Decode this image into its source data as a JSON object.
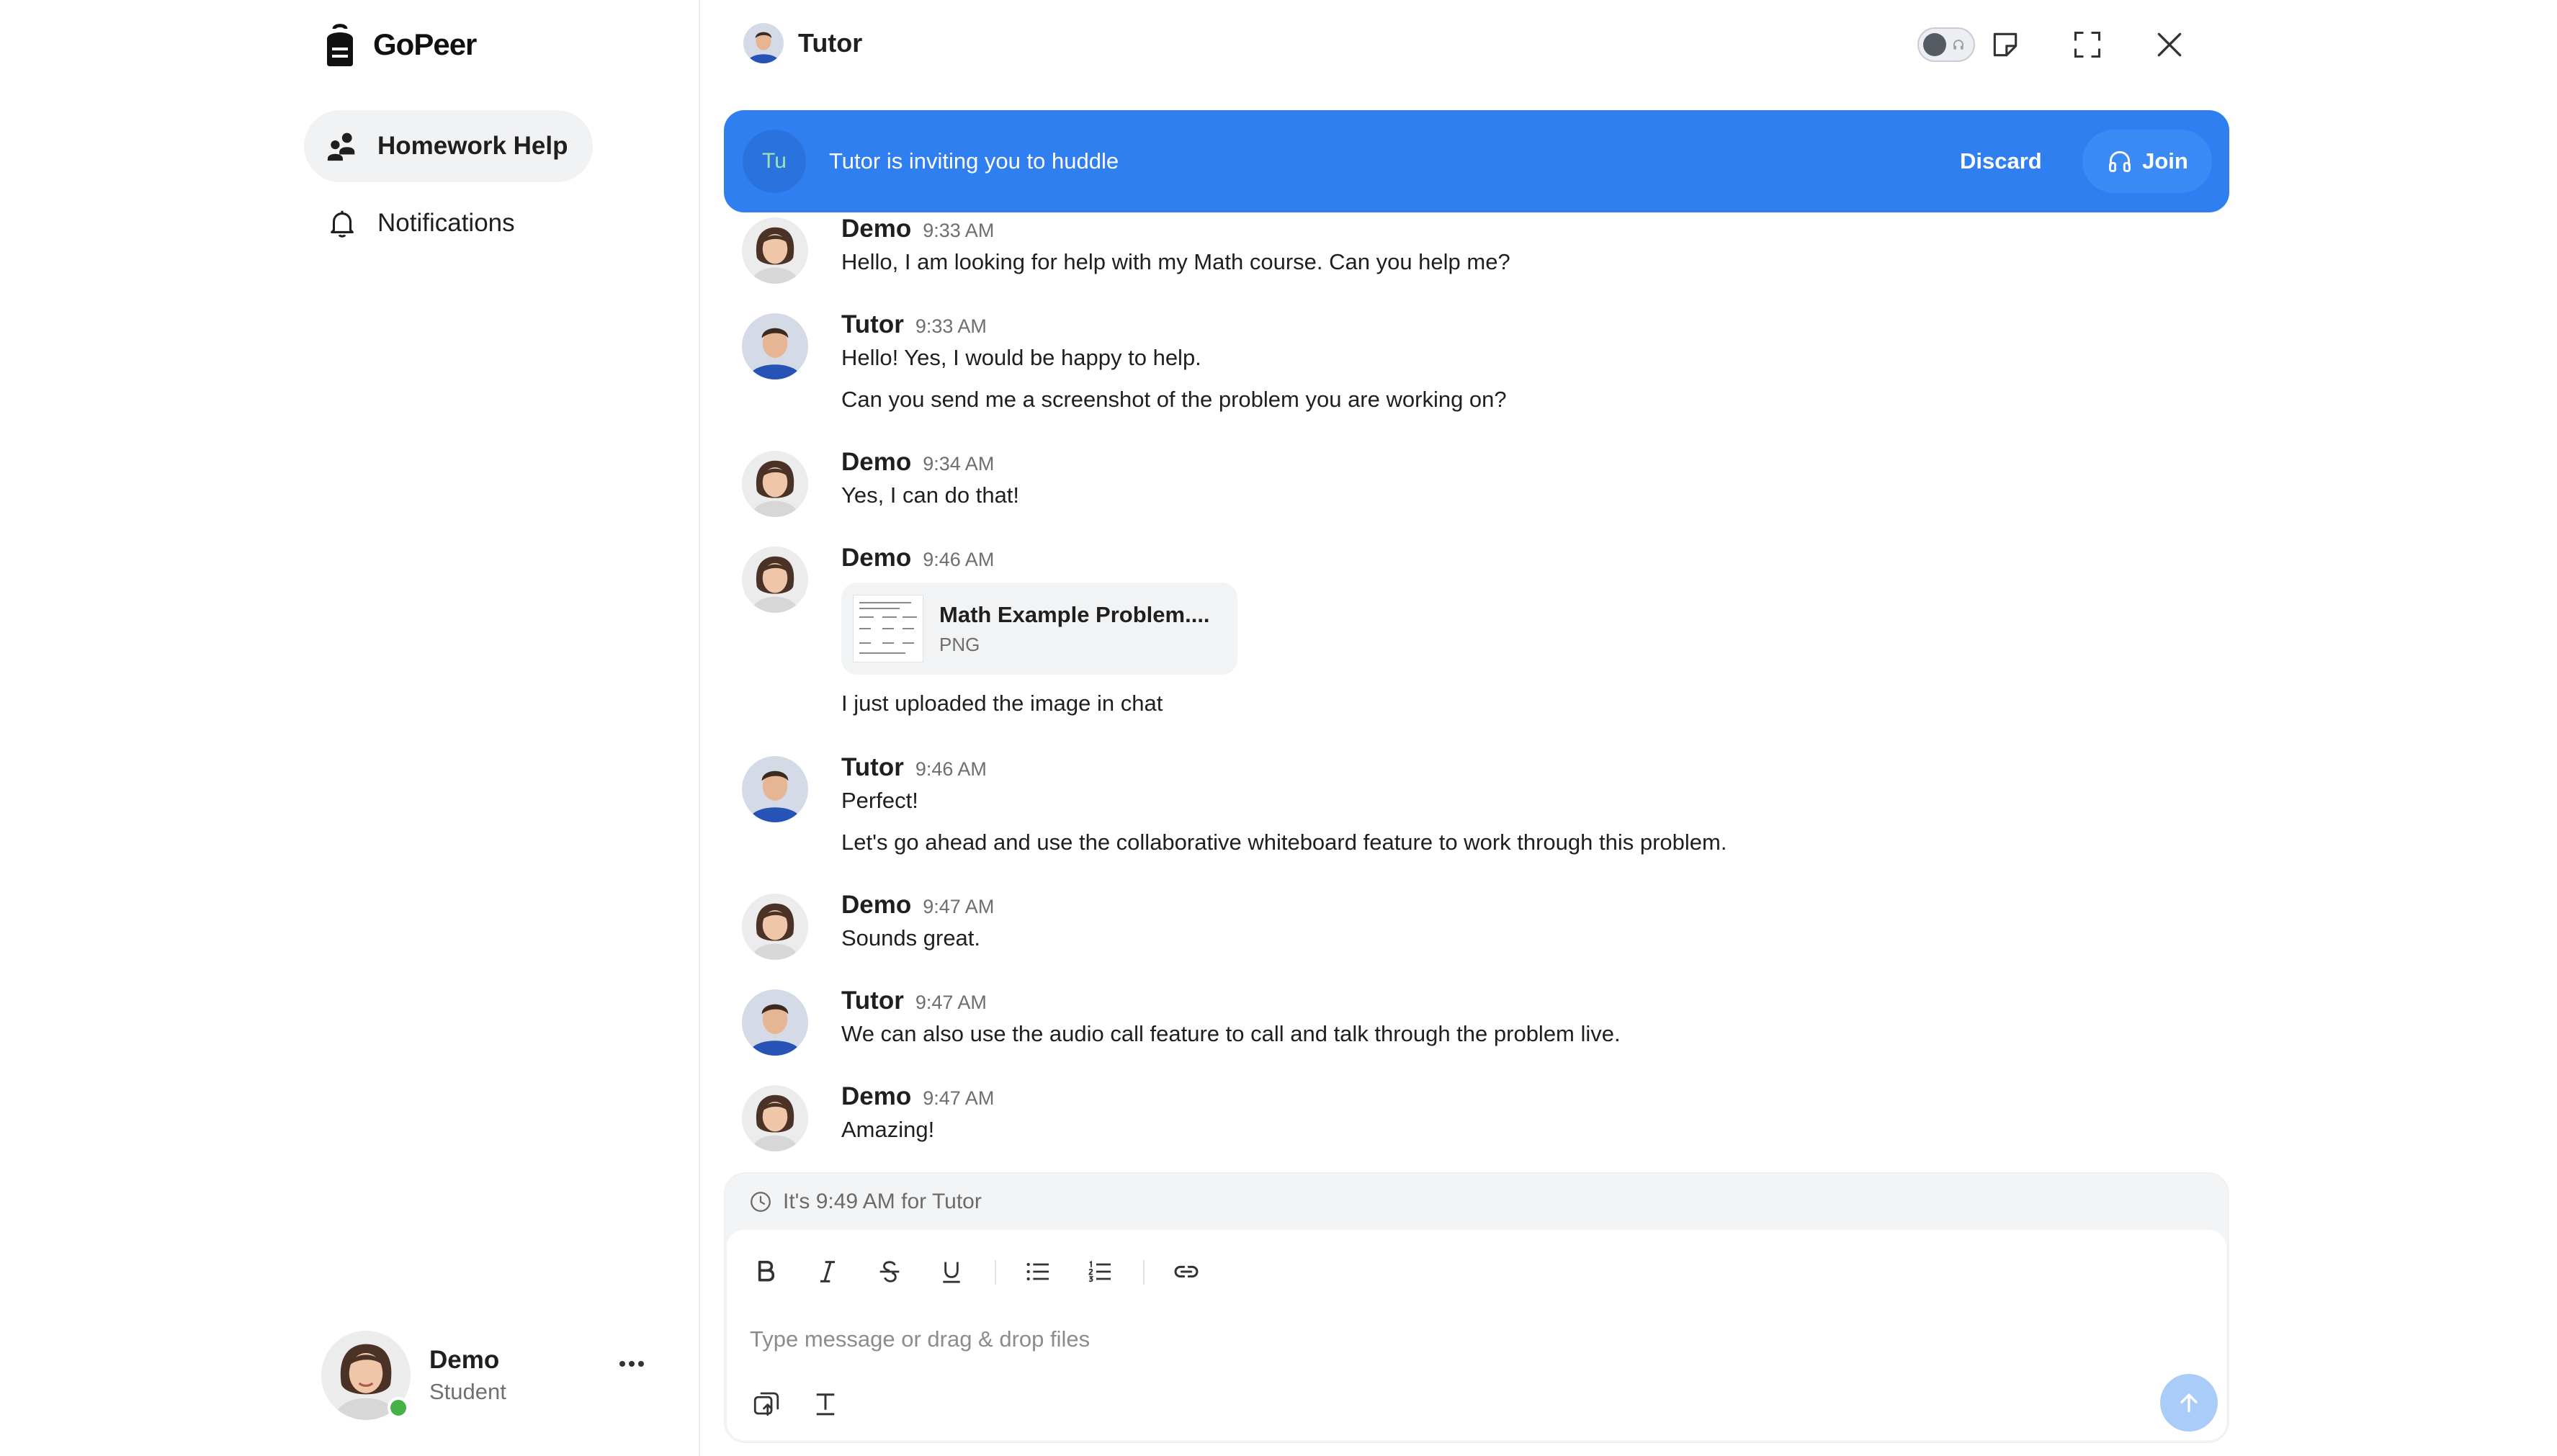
{
  "app": {
    "brand": "GoPeer"
  },
  "colors": {
    "accent": "#2f7ff1",
    "online": "#45b249"
  },
  "sidebar": {
    "items": [
      {
        "label": "Homework Help",
        "icon": "users-icon",
        "active": true
      },
      {
        "label": "Notifications",
        "icon": "bell-icon",
        "active": false
      }
    ],
    "user": {
      "name": "Demo",
      "role": "Student",
      "status": "online"
    }
  },
  "header": {
    "title": "Tutor"
  },
  "banner": {
    "badge": "Tu",
    "text": "Tutor is inviting you to huddle",
    "discard_label": "Discard",
    "join_label": "Join"
  },
  "messages": [
    {
      "author": "Demo",
      "time": "9:33 AM",
      "lines": [
        "Hello, I am looking for help with my Math course. Can you help me?"
      ]
    },
    {
      "author": "Tutor",
      "time": "9:33 AM",
      "lines": [
        "Hello! Yes, I would be happy to help.",
        "Can you send me a screenshot of the problem you are working on?"
      ]
    },
    {
      "author": "Demo",
      "time": "9:34 AM",
      "lines": [
        "Yes, I can do that!"
      ]
    },
    {
      "author": "Demo",
      "time": "9:46 AM",
      "attachment": {
        "name": "Math Example Problem....",
        "type": "PNG"
      },
      "lines": [
        "I just uploaded the image in chat"
      ]
    },
    {
      "author": "Tutor",
      "time": "9:46 AM",
      "lines": [
        "Perfect!",
        "Let's go ahead and use the collaborative whiteboard feature to work through this problem."
      ]
    },
    {
      "author": "Demo",
      "time": "9:47 AM",
      "lines": [
        "Sounds great."
      ]
    },
    {
      "author": "Tutor",
      "time": "9:47 AM",
      "lines": [
        "We can also use the audio call feature to call and talk through the problem live."
      ]
    },
    {
      "author": "Demo",
      "time": "9:47 AM",
      "lines": [
        "Amazing!"
      ]
    }
  ],
  "composer": {
    "local_time": "It's 9:49 AM for Tutor",
    "placeholder": "Type message or drag & drop files",
    "value": ""
  }
}
